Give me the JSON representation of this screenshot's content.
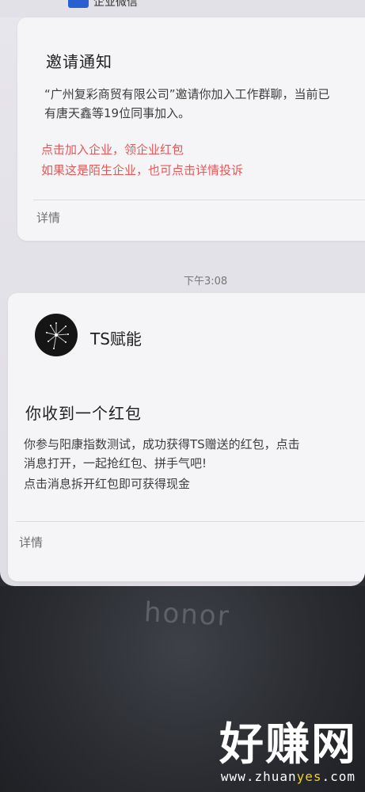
{
  "top": {
    "partial_title": "企业微信"
  },
  "invite_card": {
    "title": "邀请通知",
    "line1": "“广州复彩商贸有限公司”邀请你加入工作群聊，当前已",
    "line2": "有唐天鑫等19位同事加入。",
    "red1": "点击加入企业，领企业红包",
    "red2": "如果这是陌生企业，也可点击详情投诉",
    "details": "详情"
  },
  "time_label": "下午3:08",
  "redpacket_card": {
    "app_name": "TS赋能",
    "title": "你收到一个红包",
    "line1": "你参与阳康指数测试，成功获得TS赠送的红包，点击",
    "line2": "消息打开，一起抢红包、拼手气吧!",
    "line3": "点击消息拆开红包即可获得现金",
    "details": "详情"
  },
  "device": {
    "brand": "honor"
  },
  "watermark": {
    "main": "好赚网",
    "sub_prefix": "www.zhuan",
    "sub_accent": "yes",
    "sub_suffix": ".com"
  },
  "colors": {
    "red_text": "#e25959",
    "card_bg": "#f5f5f7",
    "screen_bg": "#e3e2e8"
  },
  "icons": {
    "avatar": "dandelion-icon"
  }
}
